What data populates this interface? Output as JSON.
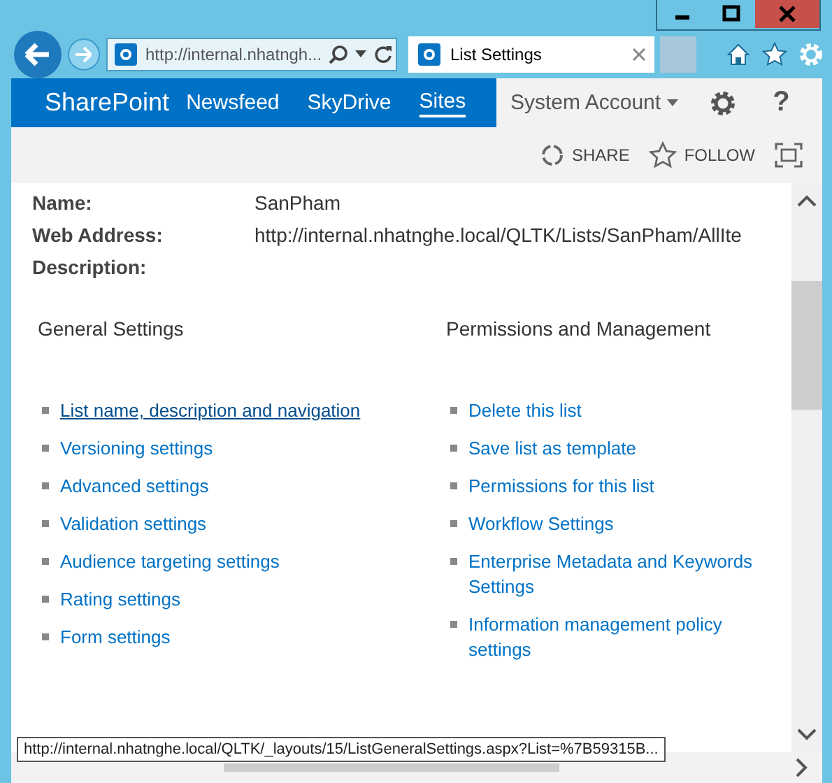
{
  "browser": {
    "address": "http://internal.nhatngh...",
    "tabs": [
      {
        "title": "List Settings",
        "selected": true
      }
    ]
  },
  "suite_bar": {
    "brand": "SharePoint",
    "links": [
      {
        "label": "Newsfeed",
        "selected": false
      },
      {
        "label": "SkyDrive",
        "selected": false
      },
      {
        "label": "Sites",
        "selected": true
      }
    ],
    "account": "System Account",
    "help": "?"
  },
  "actions": [
    "SHARE",
    "FOLLOW"
  ],
  "properties": [
    {
      "label": "Name:",
      "value": "SanPham"
    },
    {
      "label": "Web Address:",
      "value": "http://internal.nhatnghe.local/QLTK/Lists/SanPham/AllIte"
    },
    {
      "label": "Description:"
    }
  ],
  "sections": [
    {
      "heading": "General Settings",
      "links": [
        {
          "label": "List name, description and navigation",
          "hovered": true
        },
        {
          "label": "Versioning settings",
          "hovered": false
        },
        {
          "label": "Advanced settings",
          "hovered": false
        },
        {
          "label": "Validation settings",
          "hovered": false
        },
        {
          "label": "Audience targeting settings",
          "hovered": false
        },
        {
          "label": "Rating settings",
          "hovered": false
        },
        {
          "label": "Form settings",
          "hovered": false
        }
      ]
    },
    {
      "heading": "Permissions and Management",
      "links": [
        {
          "label": "Delete this list",
          "hovered": false
        },
        {
          "label": "Save list as template",
          "hovered": false
        },
        {
          "label": "Permissions for this list",
          "hovered": false
        },
        {
          "label": "Workflow Settings",
          "hovered": false
        },
        {
          "label": "Enterprise Metadata and Keywords Settings",
          "hovered": false
        },
        {
          "label": "Information management policy settings",
          "hovered": false
        }
      ]
    }
  ],
  "status_url": "http://internal.nhatnghe.local/QLTK/_layouts/15/ListGeneralSettings.aspx?List=%7B59315B..."
}
